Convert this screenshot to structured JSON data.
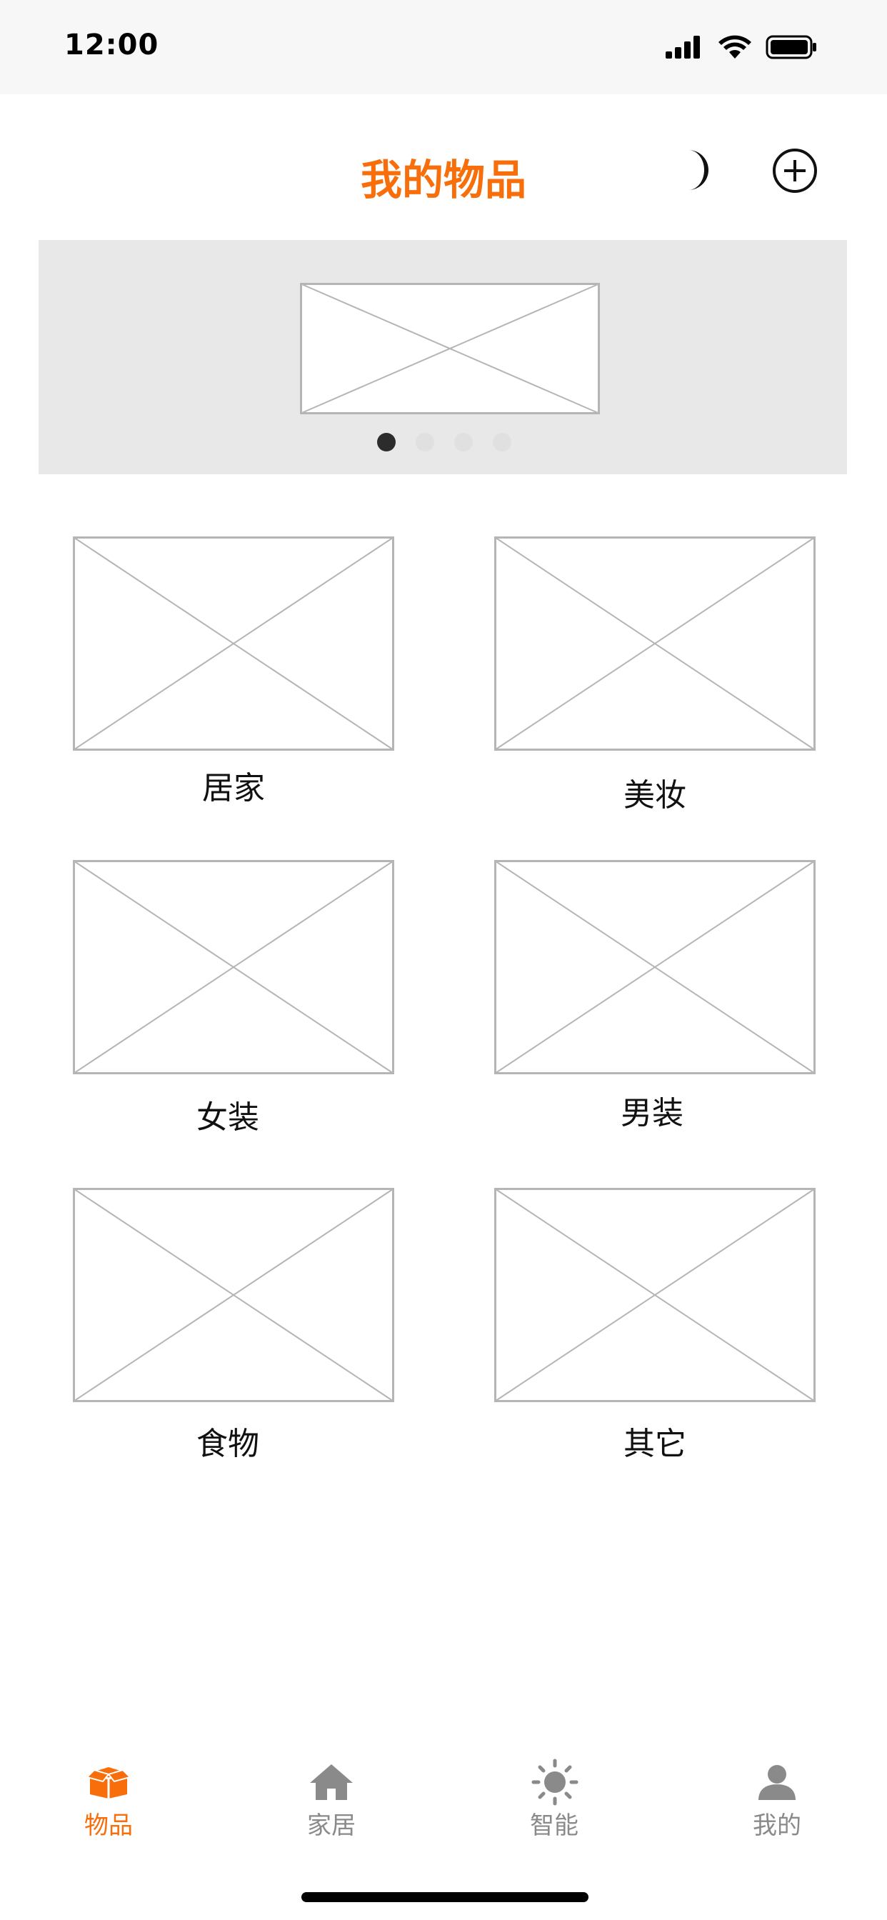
{
  "status_bar": {
    "time": "12:00"
  },
  "header": {
    "title": "我的物品"
  },
  "banner": {
    "dots": 4,
    "active_index": 0
  },
  "grid": {
    "items": [
      {
        "label": "居家"
      },
      {
        "label": "美妆"
      },
      {
        "label": "女装"
      },
      {
        "label": "男装"
      },
      {
        "label": "食物"
      },
      {
        "label": "其它"
      }
    ]
  },
  "tabbar": {
    "tabs": [
      {
        "label": "物品",
        "icon": "box-icon",
        "active": true
      },
      {
        "label": "家居",
        "icon": "home-icon",
        "active": false
      },
      {
        "label": "智能",
        "icon": "sun-icon",
        "active": false
      },
      {
        "label": "我的",
        "icon": "person-icon",
        "active": false
      }
    ]
  },
  "colors": {
    "accent": "#f76e0a",
    "inactive": "#8a8a8a",
    "banner_bg": "#e8e8e8",
    "placeholder_line": "#b5b5b5"
  }
}
